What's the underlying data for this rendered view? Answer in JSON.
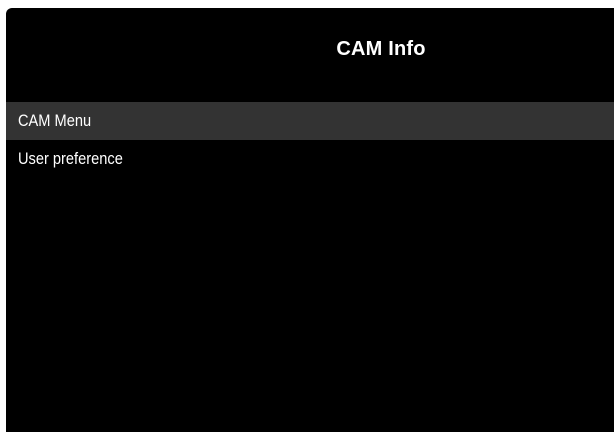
{
  "header": {
    "title": "CAM Info"
  },
  "menu": {
    "items": [
      {
        "label": "CAM Menu",
        "selected": true
      },
      {
        "label": "User preference",
        "selected": false
      }
    ]
  },
  "colors": {
    "background": "#000000",
    "selected_row": "#333333",
    "text": "#ffffff"
  }
}
